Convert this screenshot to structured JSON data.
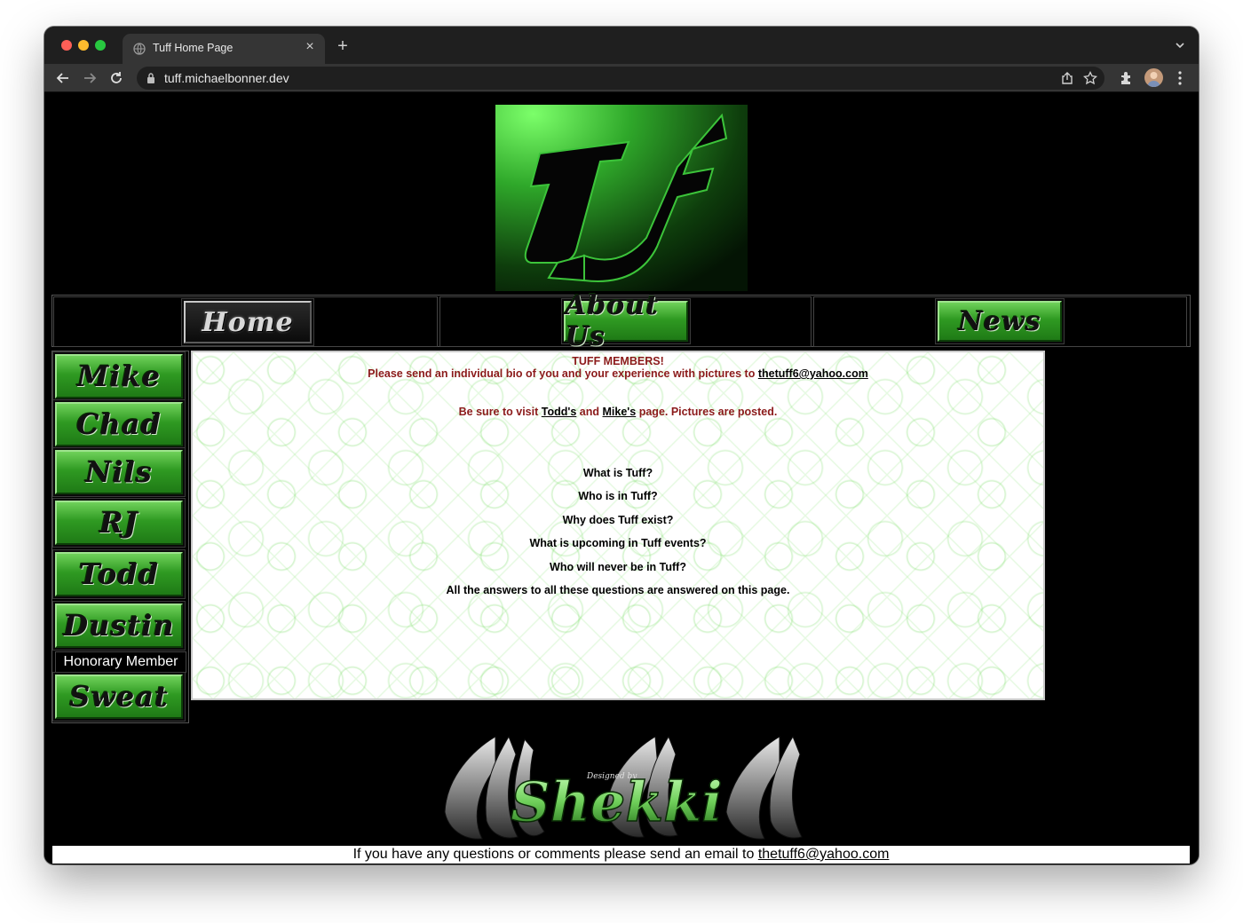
{
  "browser": {
    "tab_title": "Tuff Home Page",
    "url": "tuff.michaelbonner.dev"
  },
  "logo": {
    "alt": "TUF"
  },
  "top_nav": {
    "home": "Home",
    "about": "About Us",
    "news": "News"
  },
  "sidebar": {
    "members": [
      "Mike",
      "Chad",
      "Nils",
      "RJ",
      "Todd",
      "Dustin"
    ],
    "honorary_label": "Honorary Member",
    "honorary": "Sweat"
  },
  "content": {
    "heading": "TUFF MEMBERS!",
    "bio_text": "Please send an individual bio of you and your experience with pictures to",
    "bio_email": "thetuff6@yahoo.com",
    "visit_prefix": "Be sure to visit",
    "visit_link1": "Todd's",
    "visit_and": "and",
    "visit_link2": "Mike's",
    "visit_suffix": "page. Pictures are posted.",
    "questions": [
      "What is Tuff?",
      "Who is in Tuff?",
      "Why does Tuff exist?",
      "What is upcoming in Tuff events?",
      "Who will never be in Tuff?",
      "All the answers to all these questions are answered on this page."
    ]
  },
  "designer": {
    "small": "Designed by",
    "name": "Shekki"
  },
  "footer": {
    "text": "If you have any questions or comments please send an email to",
    "email": "thetuff6@yahoo.com"
  },
  "colors": {
    "accent_green": "#2f9a22",
    "content_red": "#8b1a1a",
    "page_bg": "#000000"
  }
}
